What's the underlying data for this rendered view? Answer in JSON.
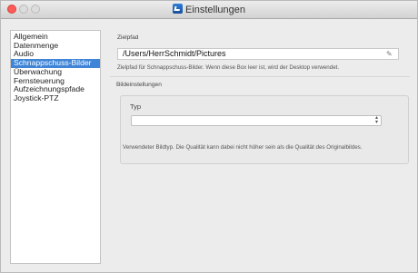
{
  "window": {
    "title": "Einstellungen"
  },
  "sidebar": {
    "items": [
      {
        "label": "Allgemein"
      },
      {
        "label": "Datenmenge"
      },
      {
        "label": "Audio"
      },
      {
        "label": "Schnappschuss-Bilder"
      },
      {
        "label": "Überwachung"
      },
      {
        "label": "Fernsteuerung"
      },
      {
        "label": "Aufzeichnungspfade"
      },
      {
        "label": "Joystick-PTZ"
      }
    ],
    "selected": "Schnappschuss-Bilder"
  },
  "zielpfad": {
    "label": "Zielpfad",
    "value": "/Users/HerrSchmidt/Pictures",
    "hint": "Zielpfad für Schnappschuss-Bilder. Wenn diese Box leer ist, wird der Desktop verwendet."
  },
  "bildeinstellungen": {
    "label": "Bildeinstellungen",
    "typ_label": "Typ",
    "typ_value": "",
    "hint": "Verwendeter Bildtyp. Die Qualität kann dabei nicht höher sein als die Qualität des Originalbildes."
  },
  "icons": {
    "app": "app-icon",
    "pencil": "pencil-icon",
    "select_arrows": "select-arrows-icon"
  }
}
